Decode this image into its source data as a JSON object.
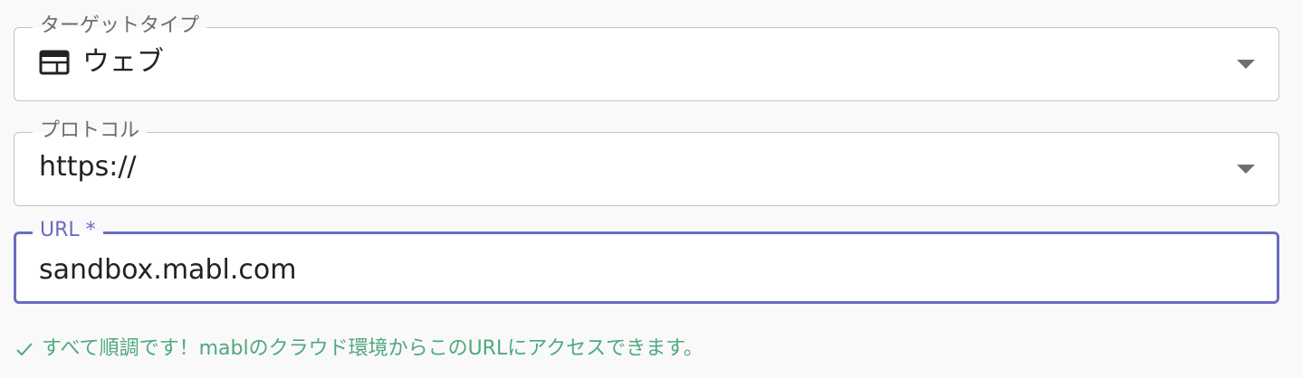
{
  "target_type": {
    "label": "ターゲットタイプ",
    "value": "ウェブ",
    "icon": "web-icon"
  },
  "protocol": {
    "label": "プロトコル",
    "value": "https://"
  },
  "url": {
    "label": "URL *",
    "value": "sandbox.mabl.com"
  },
  "helper": {
    "icon": "check-icon",
    "text": "すべて順調です！mablのクラウド環境からこのURLにアクセスできます。"
  },
  "colors": {
    "accent": "#6b6bc3",
    "success": "#4fa880",
    "border": "#c4c4c4"
  }
}
